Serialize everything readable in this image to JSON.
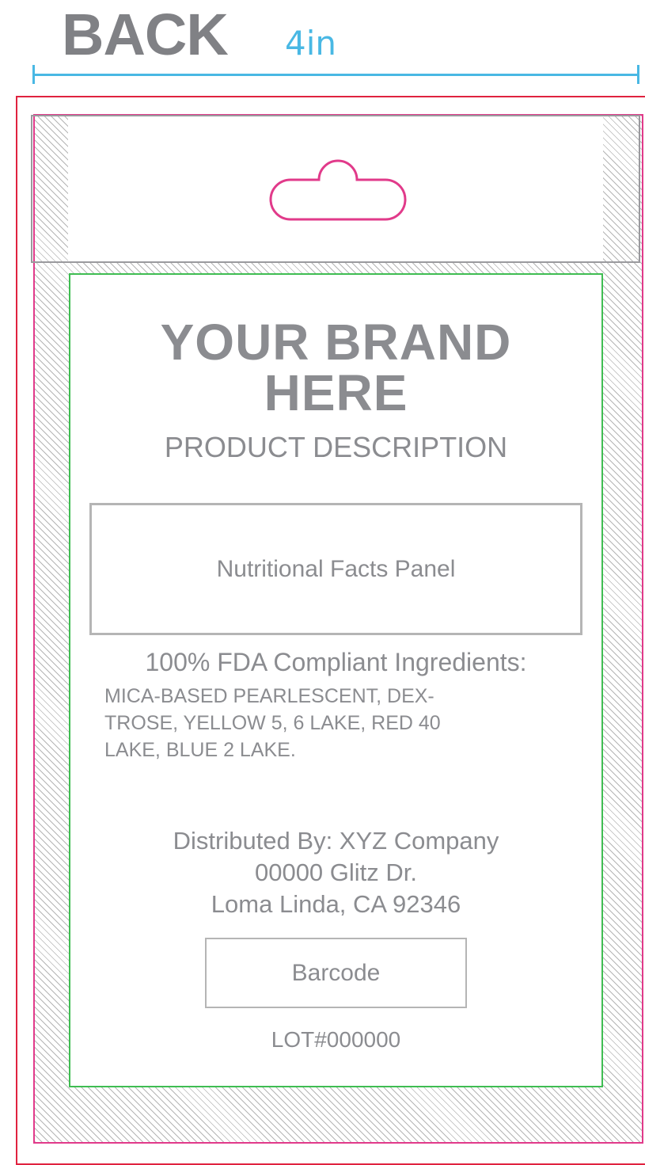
{
  "header": {
    "title": "BACK",
    "dimension": "4in"
  },
  "colors": {
    "bleed_line": "#e0223f",
    "trim_line": "#e13a8a",
    "safe_line": "#3fbd52",
    "dimension": "#49b8e4",
    "text": "#8b8c90"
  },
  "label": {
    "brand_line1": "YOUR BRAND",
    "brand_line2": "HERE",
    "product_description": "PRODUCT DESCRIPTION",
    "nutrition_panel": "Nutritional Facts Panel",
    "ingredients_heading": "100% FDA Compliant Ingredients:",
    "ingredients_line1": "MICA-BASED PEARLESCENT, DEX-",
    "ingredients_line2": "TROSE, YELLOW 5, 6 LAKE, RED 40",
    "ingredients_line3": "LAKE, BLUE 2 LAKE.",
    "distributor_line1": "Distributed By: XYZ Company",
    "distributor_line2": "00000 Glitz Dr.",
    "distributor_line3": "Loma Linda, CA 92346",
    "barcode": "Barcode",
    "lot": "LOT#000000"
  },
  "icons": {
    "hang_hole": "hang-hole-icon"
  }
}
